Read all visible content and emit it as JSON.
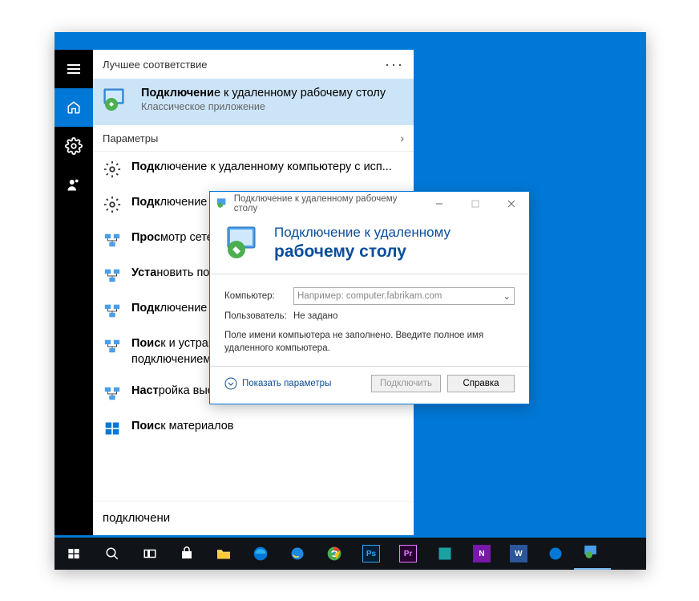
{
  "search": {
    "best_match_header": "Лучшее соответствие",
    "best_title_prefix": "Подключени",
    "best_title_suffix": "е к удаленному рабочему столу",
    "best_subtitle": "Классическое приложение",
    "params_header": "Параметры",
    "items": [
      {
        "prefix": "Подк",
        "mid": "лючение к удаленному компьютеру с исп..."
      },
      {
        "prefix": "Подк",
        "mid": "лючение к сети в домене"
      },
      {
        "prefix": "Прос",
        "mid": "мотр сетевых подключений"
      },
      {
        "prefix": "Уста",
        "mid": "новить подключение"
      },
      {
        "prefix": "Подк",
        "mid": "лючение к рабочему столу"
      },
      {
        "prefix": "Поис",
        "mid": "к и устранение проблем с сетью и подключением"
      },
      {
        "prefix": "Наст",
        "mid": "ройка высокоскоростного подключения"
      },
      {
        "prefix": "Поис",
        "mid": "к материалов"
      }
    ],
    "input_value": "подключени"
  },
  "rdp": {
    "title": "Подключение к удаленному рабочему столу",
    "banner_line1": "Подключение к удаленному",
    "banner_line2": "рабочему столу",
    "label_computer": "Компьютер:",
    "placeholder_computer": "Например: computer.fabrikam.com",
    "label_user": "Пользователь:",
    "value_user": "Не задано",
    "help_text": "Поле имени компьютера не заполнено. Введите полное имя удаленного компьютера.",
    "show_params": "Показать параметры",
    "btn_connect": "Подключить",
    "btn_help": "Справка"
  }
}
